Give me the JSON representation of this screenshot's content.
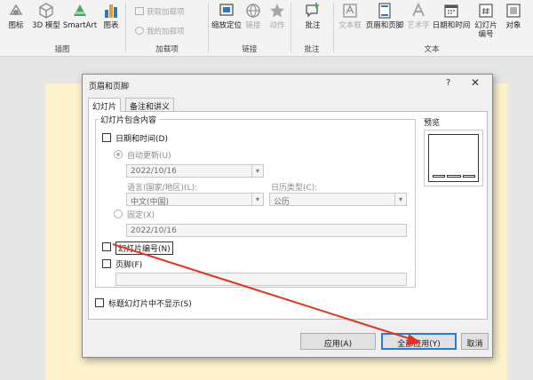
{
  "ribbon": {
    "buttons": {
      "icons": "图标",
      "models3d": "3D 模型",
      "smartart": "SmartArt",
      "chart": "图表",
      "zoom": "缩放定位",
      "link": "链接",
      "action": "动作",
      "comment": "批注",
      "textbox": "文本框",
      "header_footer": "页眉和页脚",
      "wordart": "艺术字",
      "datetime": "日期和时间",
      "slide_number": "幻灯片编号",
      "object": "对象"
    },
    "addins": {
      "get": "获取加载项",
      "mine": "我的加载项"
    },
    "groups": {
      "illustrations": "插图",
      "addins": "加载项",
      "links": "链接",
      "comments": "批注",
      "text": "文本"
    }
  },
  "dialog": {
    "title": "页眉和页脚",
    "help": "?",
    "close": "✕",
    "tabs": [
      "幻灯片",
      "备注和讲义"
    ],
    "group_label": "幻灯片包含内容",
    "date_time": {
      "label": "日期和时间(D)",
      "checked": false
    },
    "auto_update": {
      "label": "自动更新(U)",
      "value": "2022/10/16"
    },
    "language": {
      "label": "语言(国家/地区)(L):",
      "value": "中文(中国)"
    },
    "calendar": {
      "label": "日历类型(C):",
      "value": "公历"
    },
    "fixed": {
      "label": "固定(X)",
      "value": "2022/10/16"
    },
    "slide_number": {
      "label": "幻灯片编号(N)",
      "checked": false
    },
    "footer": {
      "label": "页脚(F)",
      "checked": false,
      "value": ""
    },
    "no_title": {
      "label": "标题幻灯片中不显示(S)",
      "checked": false
    },
    "preview_label": "预览",
    "buttons": {
      "apply": "应用(A)",
      "apply_all": "全部应用(Y)",
      "cancel": "取消"
    }
  },
  "colors": {
    "accent": "#2a7ad8",
    "arrow": "#e8301f",
    "slide_background": "#fdf2cc",
    "ribbon_background": "#f3f3f3"
  }
}
